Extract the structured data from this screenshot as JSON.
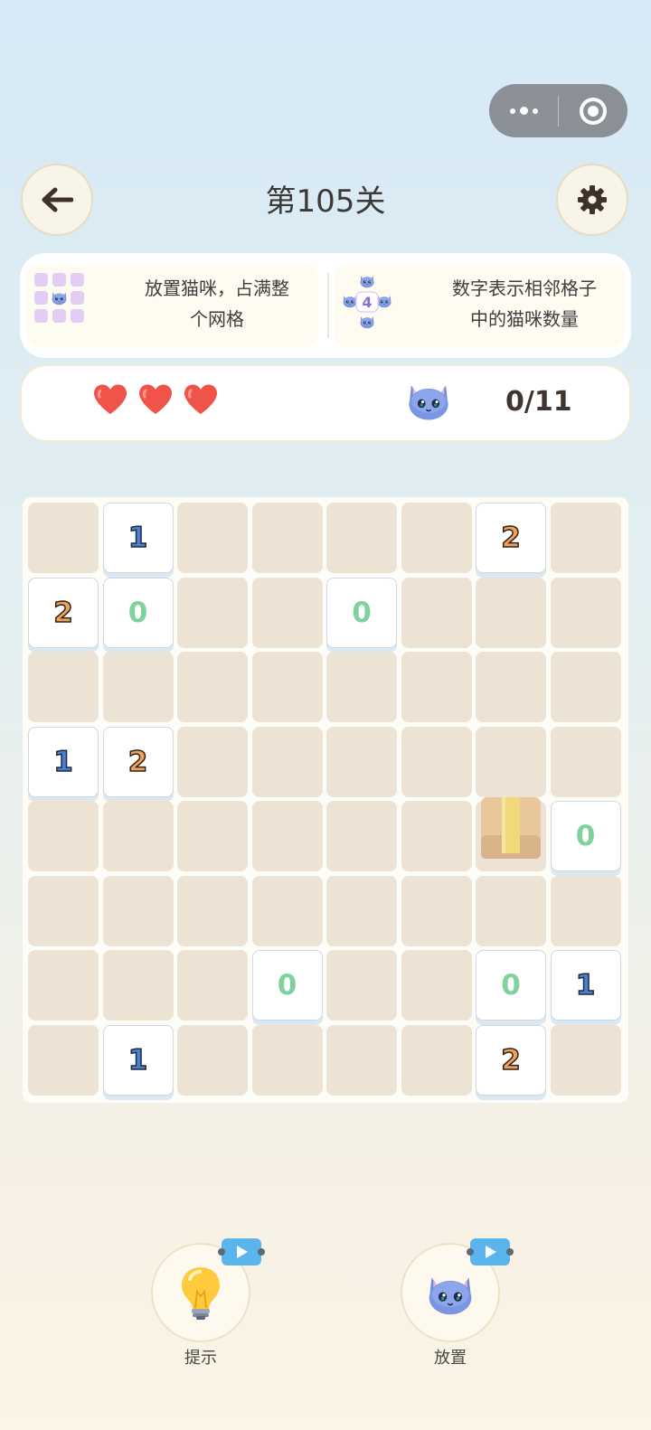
{
  "header": {
    "title": "第105关",
    "back_icon": "arrow-left-icon",
    "settings_icon": "gear-icon"
  },
  "capsule": {
    "more_icon": "more-dots-icon",
    "close_icon": "target-circle-icon"
  },
  "rules": [
    {
      "text_line1": "放置猫咪，占满整",
      "text_line2": "个网格",
      "icon": "cat-grid-icon"
    },
    {
      "text_line1": "数字表示相邻格子",
      "text_line2": "中的猫咪数量",
      "icon": "cat-adjacent-number-icon",
      "icon_number": "4"
    }
  ],
  "status": {
    "lives": 3,
    "life_icon": "heart-icon",
    "cat_icon": "cat-face-icon",
    "cat_count": "0/11"
  },
  "board": {
    "rows": 8,
    "cols": 8,
    "clues": [
      {
        "row": 0,
        "col": 1,
        "value": "1"
      },
      {
        "row": 0,
        "col": 6,
        "value": "2"
      },
      {
        "row": 1,
        "col": 0,
        "value": "2"
      },
      {
        "row": 1,
        "col": 1,
        "value": "0"
      },
      {
        "row": 1,
        "col": 4,
        "value": "0"
      },
      {
        "row": 3,
        "col": 0,
        "value": "1"
      },
      {
        "row": 3,
        "col": 1,
        "value": "2"
      },
      {
        "row": 4,
        "col": 7,
        "value": "0"
      },
      {
        "row": 6,
        "col": 3,
        "value": "0"
      },
      {
        "row": 6,
        "col": 6,
        "value": "0"
      },
      {
        "row": 6,
        "col": 7,
        "value": "1"
      },
      {
        "row": 7,
        "col": 1,
        "value": "1"
      },
      {
        "row": 7,
        "col": 6,
        "value": "2"
      }
    ],
    "box_cell": {
      "row": 4,
      "col": 6,
      "icon": "cardboard-box-icon"
    }
  },
  "tools": {
    "hint": {
      "label": "提示",
      "icon": "lightbulb-icon",
      "badge_icon": "video-play-icon"
    },
    "place": {
      "label": "放置",
      "icon": "cat-face-icon",
      "badge_icon": "video-play-icon"
    }
  },
  "colors": {
    "cell_empty": "#ece3d5",
    "clue_bg": "#ffffff",
    "clue_0": "#7fd19d",
    "clue_1": "#4a7fd7",
    "clue_2": "#f1a25a",
    "heart": "#f0534a",
    "badge": "#5bb4ec"
  }
}
